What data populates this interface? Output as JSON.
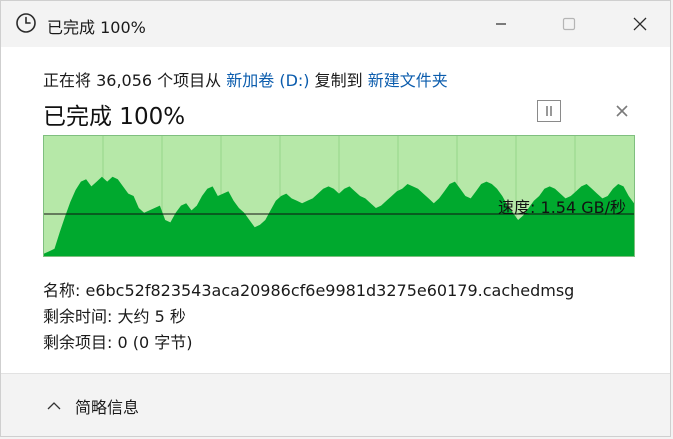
{
  "window": {
    "title": "已完成 100%"
  },
  "summary": {
    "prefix": "正在将 36,056 个项目从 ",
    "source": "新加卷 (D:)",
    "middle": " 复制到 ",
    "destination": "新建文件夹"
  },
  "status": {
    "progress_text": "已完成 100%",
    "progress_percent": 100
  },
  "graph": {
    "speed_label": "速度: 1.54 GB/秒",
    "current_speed_line_fraction": 0.35,
    "throughput_series": [
      0.02,
      0.04,
      0.06,
      0.2,
      0.33,
      0.45,
      0.55,
      0.62,
      0.64,
      0.58,
      0.62,
      0.66,
      0.62,
      0.66,
      0.64,
      0.58,
      0.52,
      0.5,
      0.4,
      0.36,
      0.38,
      0.4,
      0.42,
      0.3,
      0.28,
      0.36,
      0.42,
      0.44,
      0.38,
      0.42,
      0.5,
      0.56,
      0.58,
      0.5,
      0.52,
      0.54,
      0.46,
      0.4,
      0.36,
      0.3,
      0.24,
      0.26,
      0.3,
      0.38,
      0.46,
      0.5,
      0.52,
      0.48,
      0.46,
      0.44,
      0.46,
      0.48,
      0.52,
      0.56,
      0.58,
      0.56,
      0.52,
      0.56,
      0.58,
      0.54,
      0.5,
      0.48,
      0.44,
      0.4,
      0.42,
      0.46,
      0.5,
      0.54,
      0.56,
      0.6,
      0.58,
      0.56,
      0.52,
      0.48,
      0.44,
      0.48,
      0.54,
      0.6,
      0.62,
      0.56,
      0.5,
      0.48,
      0.54,
      0.6,
      0.62,
      0.6,
      0.56,
      0.5,
      0.42,
      0.36,
      0.3,
      0.34,
      0.4,
      0.46,
      0.5,
      0.56,
      0.58,
      0.56,
      0.52,
      0.48,
      0.5,
      0.54,
      0.58,
      0.6,
      0.56,
      0.52,
      0.48,
      0.5,
      0.56,
      0.6,
      0.58,
      0.5,
      0.44
    ]
  },
  "details": {
    "name_label": "名称: ",
    "name_value": "e6bc52f823543aca20986cf6e9981d3275e60179.cachedmsg",
    "time_label": "剩余时间: ",
    "time_value": "大约 5 秒",
    "items_label": "剩余项目: ",
    "items_value": "0 (0 字节)"
  },
  "footer": {
    "toggle_label": "简略信息"
  },
  "colors": {
    "accent_link": "#0b5cad",
    "graph_fill": "#00a92e",
    "graph_bg": "#b6e8a8",
    "graph_grid": "#96d68a"
  }
}
